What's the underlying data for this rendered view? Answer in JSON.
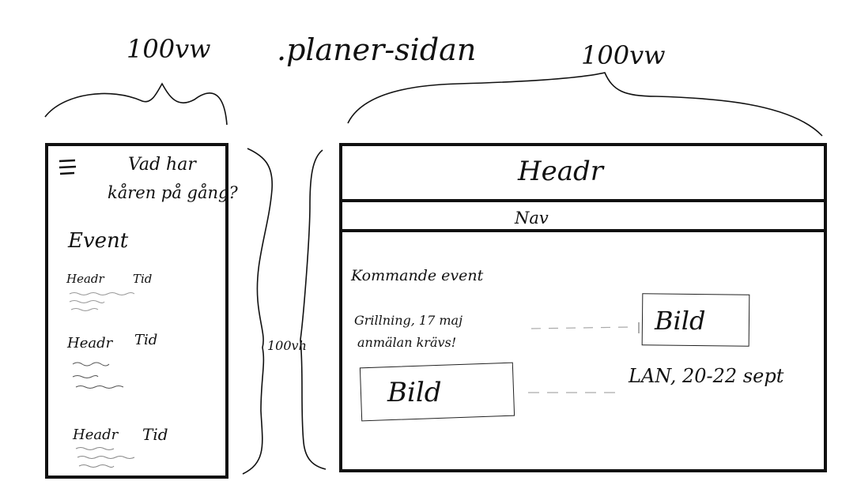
{
  "top_labels": {
    "mobile_width": "100vw",
    "page_name": ".planer-sidan",
    "desktop_width": "100vw"
  },
  "height_labels": {
    "mobile_height": "100vh"
  },
  "mobile": {
    "menu_icon": "hamburger-icon",
    "title_line1": "Vad har",
    "title_line2": "kåren på gång?",
    "section_title": "Event",
    "events": [
      {
        "header": "Headr",
        "time": "Tid"
      },
      {
        "header": "Headr",
        "time": "Tid"
      },
      {
        "header": "Headr",
        "time": "Tid"
      }
    ]
  },
  "desktop": {
    "header": "Headr",
    "nav": "Nav",
    "section_title": "Kommande event",
    "event1_line1": "Grillning, 17 maj",
    "event1_line2": "anmälan krävs!",
    "event1_image": "Bild",
    "event2_image": "Bild",
    "event2_text": "LAN, 20-22 sept"
  }
}
